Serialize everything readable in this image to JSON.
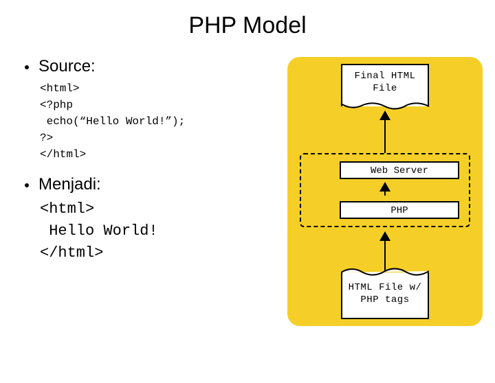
{
  "title": "PHP Model",
  "left": {
    "source_label": "Source:",
    "source_code": "<html>\n<?php\n echo(“Hello World!”);\n?>\n</html>",
    "menjadi_label": "Menjadi:",
    "result_code": "<html>\n Hello World!\n</html>"
  },
  "diagram": {
    "top_doc": "Final HTML\nFile",
    "web_server": "Web Server",
    "php": "PHP",
    "bottom_doc": "HTML File\nw/ PHP tags"
  }
}
